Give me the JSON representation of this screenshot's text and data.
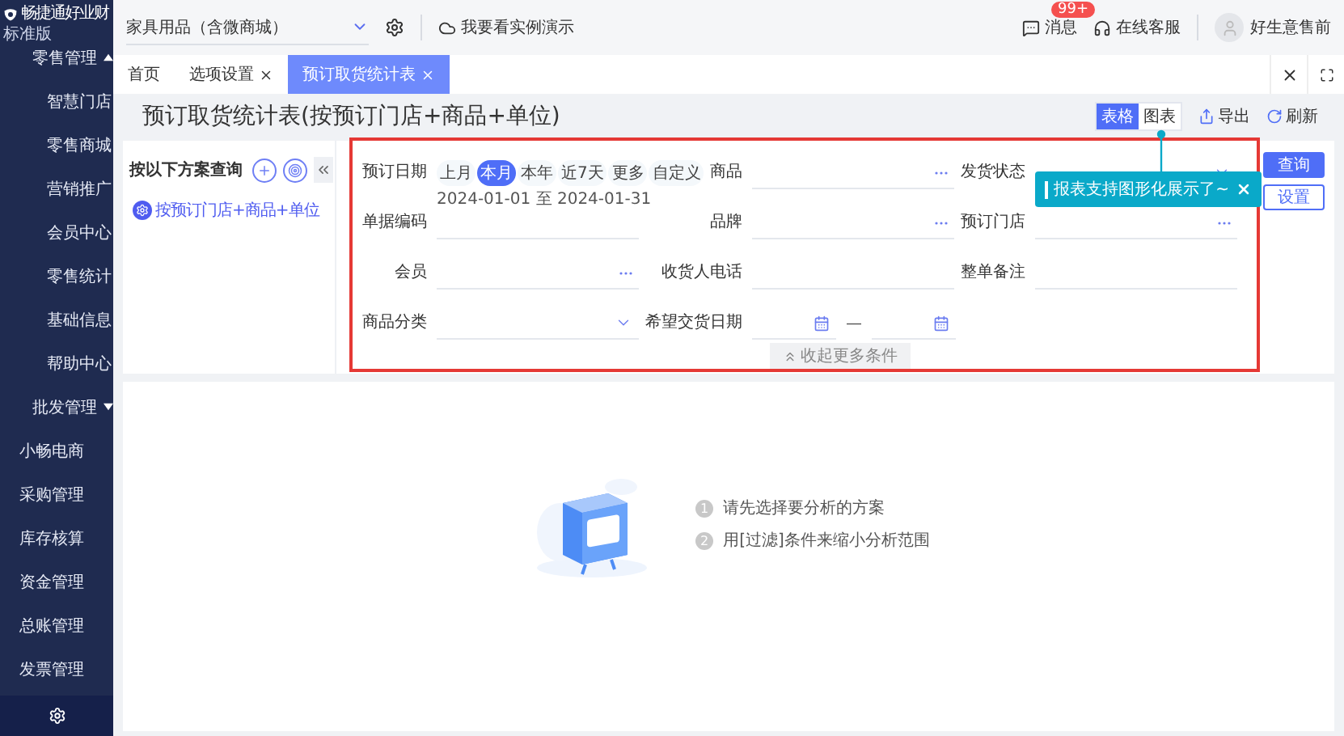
{
  "sidebar": {
    "logo": "畅捷通好业财",
    "edition": "标准版",
    "items": [
      {
        "kind": "group",
        "label": "零售管理",
        "expanded": true,
        "children": [
          {
            "kind": "item",
            "label": "智慧门店"
          },
          {
            "kind": "item",
            "label": "零售商城"
          },
          {
            "kind": "item",
            "label": "营销推广"
          },
          {
            "kind": "item",
            "label": "会员中心"
          },
          {
            "kind": "item",
            "label": "零售统计"
          },
          {
            "kind": "item",
            "label": "基础信息"
          },
          {
            "kind": "item",
            "label": "帮助中心"
          }
        ]
      },
      {
        "kind": "group",
        "label": "批发管理",
        "expanded": false
      },
      {
        "kind": "item",
        "label": "小畅电商"
      },
      {
        "kind": "item",
        "label": "采购管理"
      },
      {
        "kind": "item",
        "label": "库存核算"
      },
      {
        "kind": "item",
        "label": "资金管理"
      },
      {
        "kind": "item",
        "label": "总账管理"
      },
      {
        "kind": "item",
        "label": "发票管理"
      }
    ]
  },
  "topbar": {
    "store_selector": "家具用品（含微商城）",
    "demo_link": "我要看实例演示",
    "messages": {
      "label": "消息",
      "badge": "99+"
    },
    "support": "在线客服",
    "user": "好生意售前"
  },
  "tabs": [
    {
      "label": "首页",
      "closable": false,
      "selected": false
    },
    {
      "label": "选项设置",
      "closable": true,
      "selected": false
    },
    {
      "label": "预订取货统计表",
      "closable": true,
      "selected": true
    }
  ],
  "page": {
    "title": "预订取货统计表(按预订门店+商品+单位)",
    "view_toggle": [
      {
        "label": "表格",
        "selected": true
      },
      {
        "label": "图表",
        "selected": false
      }
    ],
    "actions": [
      {
        "kind": "export",
        "label": "导出"
      },
      {
        "kind": "refresh",
        "label": "刷新"
      }
    ]
  },
  "scheme_panel": {
    "title": "按以下方案查询",
    "schemes": [
      {
        "label": "按预订门店+商品+单位",
        "selected": true
      }
    ]
  },
  "filters": {
    "fields": [
      {
        "kind": "date-quick",
        "label": "预订日期",
        "options": [
          {
            "label": "上月",
            "selected": false
          },
          {
            "label": "本月",
            "selected": true
          },
          {
            "label": "本年",
            "selected": false
          },
          {
            "label": "近7天",
            "selected": false
          },
          {
            "label": "更多",
            "selected": false
          },
          {
            "label": "自定义",
            "selected": false
          }
        ],
        "range": "2024-01-01 至 2024-01-31"
      },
      {
        "kind": "lookup",
        "label": "商品"
      },
      {
        "kind": "select",
        "label": "发货状态"
      },
      {
        "kind": "text",
        "label": "单据编码"
      },
      {
        "kind": "lookup",
        "label": "品牌"
      },
      {
        "kind": "lookup",
        "label": "预订门店"
      },
      {
        "kind": "lookup",
        "label": "会员"
      },
      {
        "kind": "text",
        "label": "收货人电话"
      },
      {
        "kind": "text",
        "label": "整单备注"
      },
      {
        "kind": "select",
        "label": "商品分类"
      },
      {
        "kind": "date-range",
        "label": "希望交货日期",
        "separator": "—"
      }
    ],
    "collapse": "收起更多条件",
    "buttons": [
      {
        "kind": "primary",
        "label": "查询"
      },
      {
        "kind": "secondary",
        "label": "设置"
      }
    ]
  },
  "tooltip": {
    "text": "报表支持图形化展示了~"
  },
  "empty_state": {
    "steps": [
      {
        "number": "1",
        "text": "请先选择要分析的方案"
      },
      {
        "number": "2",
        "text": "用[过滤]条件来缩小分析范围"
      }
    ]
  }
}
